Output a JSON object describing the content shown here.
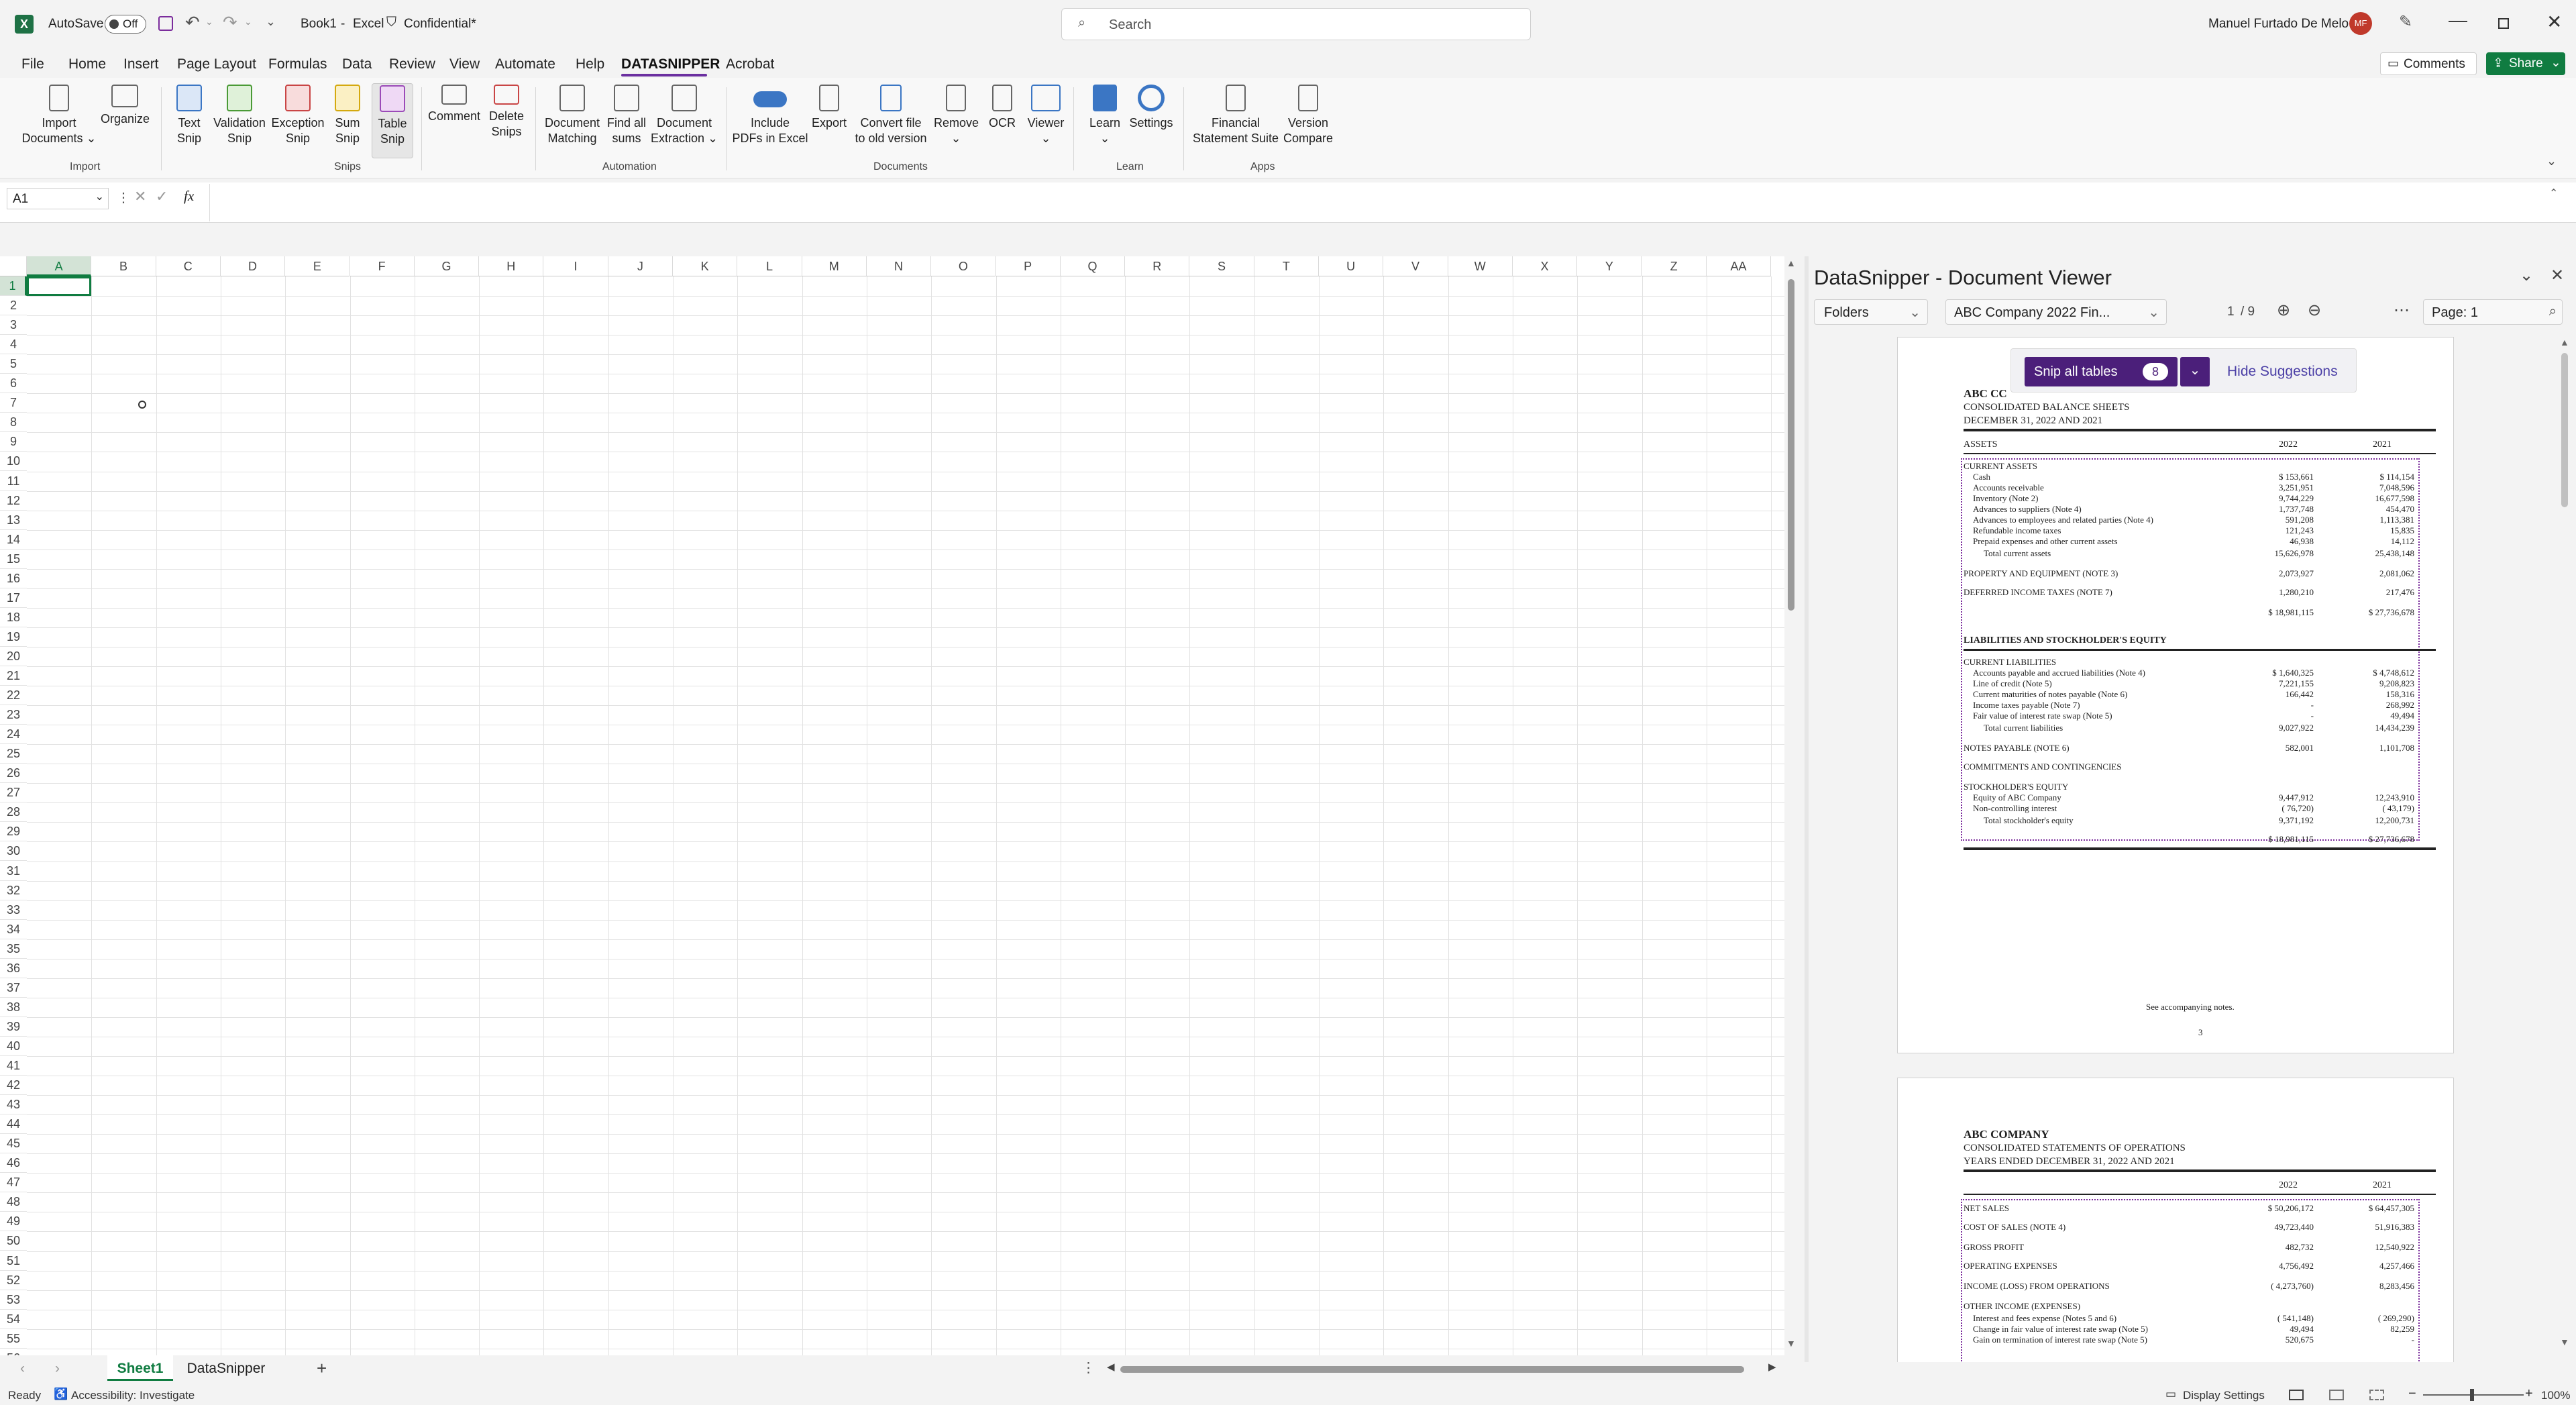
{
  "titlebar": {
    "autosave_label": "AutoSave",
    "autosave_state": "Off",
    "doc_title": "Book1",
    "app_name": "Excel",
    "sensitivity": "Confidential*",
    "search_placeholder": "Search",
    "user_name": "Manuel Furtado De Melo",
    "user_initials": "MF"
  },
  "menu": {
    "items": [
      "File",
      "Home",
      "Insert",
      "Page Layout",
      "Formulas",
      "Data",
      "Review",
      "View",
      "Automate",
      "Help",
      "DATASNIPPER",
      "Acrobat"
    ],
    "active": "DATASNIPPER",
    "comments_label": "Comments",
    "share_label": "Share"
  },
  "ribbon": {
    "import_documents": [
      "Import",
      "Documents ⌄"
    ],
    "organize": [
      "Organize",
      ""
    ],
    "text_snip": [
      "Text",
      "Snip"
    ],
    "validation_snip": [
      "Validation",
      "Snip"
    ],
    "exception_snip": [
      "Exception",
      "Snip"
    ],
    "sum_snip": [
      "Sum",
      "Snip"
    ],
    "table_snip": [
      "Table",
      "Snip"
    ],
    "comment": [
      "Comment",
      ""
    ],
    "delete_snips": [
      "Delete",
      "Snips"
    ],
    "document_matching": [
      "Document",
      "Matching"
    ],
    "find_all_sums": [
      "Find all",
      "sums"
    ],
    "document_extraction": [
      "Document",
      "Extraction ⌄"
    ],
    "include_pdfs": [
      "Include",
      "PDFs in Excel"
    ],
    "export": [
      "Export",
      ""
    ],
    "convert_file": [
      "Convert file",
      "to old version"
    ],
    "remove": [
      "Remove",
      "⌄"
    ],
    "ocr": [
      "OCR",
      ""
    ],
    "viewer": [
      "Viewer",
      "⌄"
    ],
    "learn": [
      "Learn",
      "⌄"
    ],
    "settings": [
      "Settings",
      ""
    ],
    "financial_statement_suite": [
      "Financial",
      "Statement Suite"
    ],
    "version_compare": [
      "Version",
      "Compare"
    ],
    "groups": {
      "import": "Import",
      "snips": "Snips",
      "automation": "Automation",
      "documents": "Documents",
      "learn": "Learn",
      "apps": "Apps"
    }
  },
  "formula_bar": {
    "name_box": "A1",
    "fx": "fx",
    "formula": ""
  },
  "grid": {
    "columns": [
      "A",
      "B",
      "C",
      "D",
      "E",
      "F",
      "G",
      "H",
      "I",
      "J",
      "K",
      "L",
      "M",
      "N",
      "O",
      "P",
      "Q",
      "R",
      "S",
      "T",
      "U",
      "V",
      "W",
      "X",
      "Y",
      "Z",
      "AA"
    ],
    "rows": [
      "1",
      "2",
      "3",
      "4",
      "5",
      "6",
      "7",
      "8",
      "9",
      "10",
      "11",
      "12",
      "13",
      "14",
      "15",
      "16",
      "17",
      "18",
      "19",
      "20",
      "21",
      "22",
      "23",
      "24",
      "25",
      "26",
      "27",
      "28",
      "29",
      "30",
      "31",
      "32",
      "33",
      "34",
      "35",
      "36",
      "37",
      "38",
      "39",
      "40",
      "41",
      "42",
      "43",
      "44",
      "45",
      "46",
      "47",
      "48",
      "49",
      "50",
      "51",
      "52",
      "53",
      "54",
      "55",
      "56"
    ],
    "selected_cell": "A1"
  },
  "sheets": {
    "tabs": [
      "Sheet1",
      "DataSnipper"
    ],
    "active": "Sheet1"
  },
  "status": {
    "ready": "Ready",
    "accessibility": "Accessibility: Investigate",
    "display_settings": "Display Settings",
    "zoom": "100%"
  },
  "viewer": {
    "title": "DataSnipper - Document Viewer",
    "folders_label": "Folders",
    "document_name": "ABC Company 2022 Fin...",
    "page_current": "1",
    "page_total": "/ 9",
    "page_box": "Page: 1",
    "snip_all_tables": "Snip all tables",
    "snip_count": "8",
    "hide_suggestions": "Hide Suggestions"
  },
  "page1": {
    "company": "ABC CC",
    "title": "CONSOLIDATED BALANCE SHEETS",
    "date": "DECEMBER 31, 2022 AND 2021",
    "assets": "ASSETS",
    "y2022": "2022",
    "y2021": "2021",
    "current_assets": "CURRENT ASSETS",
    "rows": [
      {
        "label": "Cash",
        "a": "$   153,661",
        "b": "$   114,154"
      },
      {
        "label": "Accounts receivable",
        "a": "3,251,951",
        "b": "7,048,596"
      },
      {
        "label": "Inventory (Note 2)",
        "a": "9,744,229",
        "b": "16,677,598"
      },
      {
        "label": "Advances to suppliers (Note 4)",
        "a": "1,737,748",
        "b": "454,470"
      },
      {
        "label": "Advances to employees and related parties (Note 4)",
        "a": "591,208",
        "b": "1,113,381"
      },
      {
        "label": "Refundable income taxes",
        "a": "121,243",
        "b": "15,835"
      },
      {
        "label": "Prepaid expenses and other current assets",
        "a": "46,938",
        "b": "14,112"
      },
      {
        "label": "Total current assets",
        "a": "15,626,978",
        "b": "25,438,148"
      },
      {
        "label": "PROPERTY AND EQUIPMENT (NOTE 3)",
        "a": "2,073,927",
        "b": "2,081,062"
      },
      {
        "label": "DEFERRED INCOME TAXES (NOTE 7)",
        "a": "1,280,210",
        "b": "217,476"
      },
      {
        "label": "",
        "a": "$  18,981,115",
        "b": "$  27,736,678"
      }
    ],
    "liabilities_head": "LIABILITIES AND STOCKHOLDER'S EQUITY",
    "current_liabilities": "CURRENT LIABILITIES",
    "rows2": [
      {
        "label": "Accounts payable and accrued liabilities (Note 4)",
        "a": "$   1,640,325",
        "b": "$   4,748,612"
      },
      {
        "label": "Line of credit (Note 5)",
        "a": "7,221,155",
        "b": "9,208,823"
      },
      {
        "label": "Current maturities of notes payable (Note 6)",
        "a": "166,442",
        "b": "158,316"
      },
      {
        "label": "Income taxes payable (Note 7)",
        "a": "-",
        "b": "268,992"
      },
      {
        "label": "Fair value of interest rate swap (Note 5)",
        "a": "-",
        "b": "49,494"
      },
      {
        "label": "Total current liabilities",
        "a": "9,027,922",
        "b": "14,434,239"
      },
      {
        "label": "NOTES PAYABLE (NOTE 6)",
        "a": "582,001",
        "b": "1,101,708"
      },
      {
        "label": "COMMITMENTS AND CONTINGENCIES",
        "a": "",
        "b": ""
      },
      {
        "label": "STOCKHOLDER'S EQUITY",
        "a": "",
        "b": ""
      },
      {
        "label": "Equity of ABC Company",
        "a": "9,447,912",
        "b": "12,243,910"
      },
      {
        "label": "Non-controlling interest",
        "a": "(     76,720)",
        "b": "(     43,179)"
      },
      {
        "label": "Total stockholder's equity",
        "a": "9,371,192",
        "b": "12,200,731"
      },
      {
        "label": "",
        "a": "$  18,981,115",
        "b": "$  27,736,678"
      }
    ],
    "notes": "See accompanying notes.",
    "page_number": "3"
  },
  "page2": {
    "company": "ABC COMPANY",
    "title": "CONSOLIDATED STATEMENTS OF OPERATIONS",
    "date": "YEARS ENDED DECEMBER 31, 2022 AND 2021",
    "y2022": "2022",
    "y2021": "2021",
    "rows": [
      {
        "label": "NET SALES",
        "a": "$  50,206,172",
        "b": "$  64,457,305"
      },
      {
        "label": "COST OF SALES (NOTE 4)",
        "a": "49,723,440",
        "b": "51,916,383"
      },
      {
        "label": "GROSS PROFIT",
        "a": "482,732",
        "b": "12,540,922"
      },
      {
        "label": "OPERATING EXPENSES",
        "a": "4,756,492",
        "b": "4,257,466"
      },
      {
        "label": "INCOME (LOSS) FROM OPERATIONS",
        "a": "(  4,273,760)",
        "b": "8,283,456"
      },
      {
        "label": "OTHER INCOME (EXPENSES)",
        "a": "",
        "b": ""
      },
      {
        "label": "Interest and fees expense (Notes 5 and 6)",
        "a": "(    541,148)",
        "b": "(    269,290)"
      },
      {
        "label": "Change in fair value of interest rate swap (Note 5)",
        "a": "49,494",
        "b": "82,259"
      },
      {
        "label": "Gain on termination of interest rate swap (Note 5)",
        "a": "520,675",
        "b": "-"
      }
    ]
  },
  "colors": {
    "excel_green": "#1e7145",
    "datasnipper_accent": "#6b2fa0",
    "share_green": "#107c41",
    "snip_border": "#7b2c9c"
  }
}
